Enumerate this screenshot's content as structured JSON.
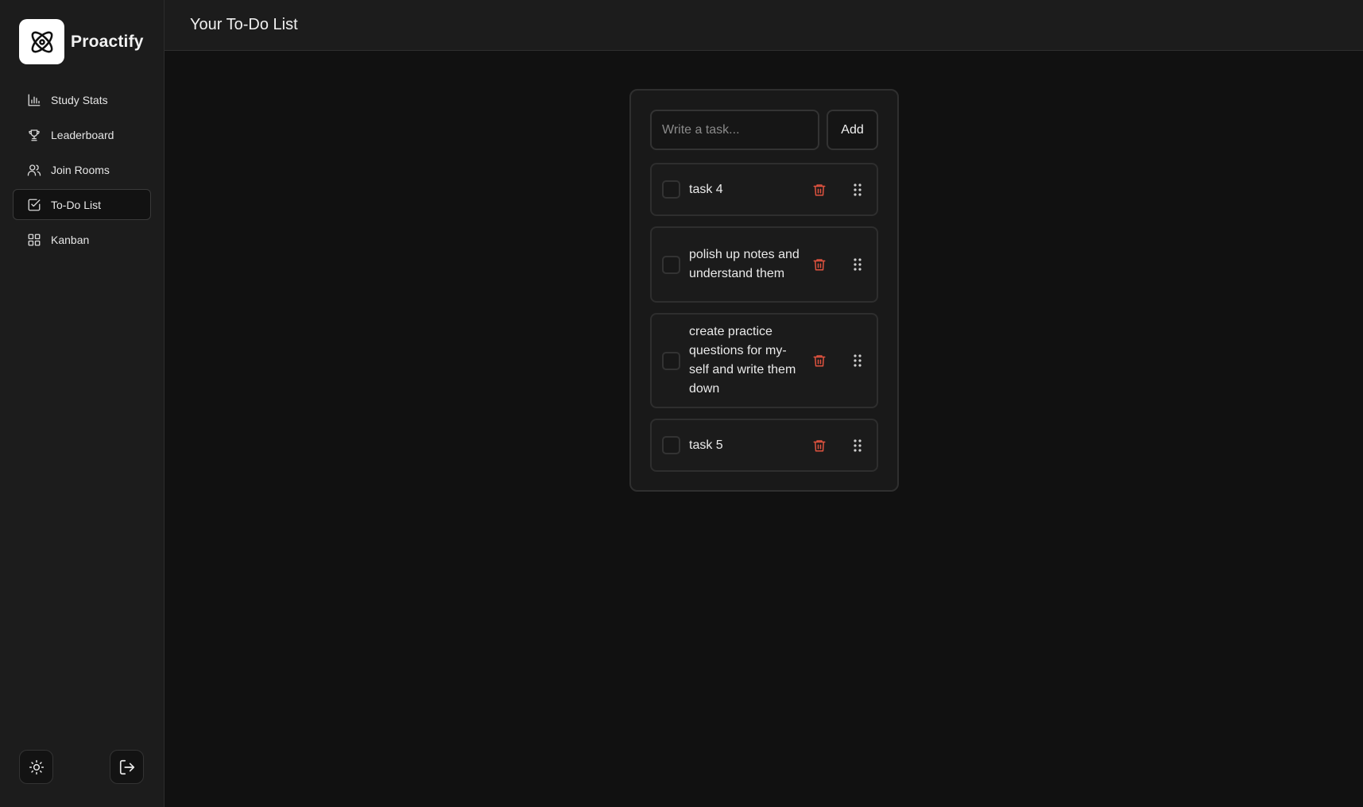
{
  "brand": {
    "name": "Proactify"
  },
  "header": {
    "title": "Your To-Do List"
  },
  "sidebar": {
    "items": [
      {
        "label": "Study Stats",
        "icon": "bar-chart-icon",
        "active": false
      },
      {
        "label": "Leaderboard",
        "icon": "trophy-icon",
        "active": false
      },
      {
        "label": "Join Rooms",
        "icon": "users-icon",
        "active": false
      },
      {
        "label": "To-Do List",
        "icon": "checkbox-icon",
        "active": true
      },
      {
        "label": "Kanban",
        "icon": "grid-icon",
        "active": false
      }
    ],
    "bottom": [
      {
        "icon": "sun-icon",
        "label": "theme toggle"
      },
      {
        "icon": "logout-icon",
        "label": "log out"
      }
    ]
  },
  "todo": {
    "input_placeholder": "Write a task...",
    "add_label": "Add",
    "tasks": [
      {
        "text": "task 4",
        "done": false
      },
      {
        "text": "polish up notes and understand them",
        "done": false
      },
      {
        "text": "create practice questions for my-self and write them down",
        "done": false
      },
      {
        "text": "task 5",
        "done": false
      }
    ]
  },
  "colors": {
    "background": "#111111",
    "sidebar": "#1c1c1c",
    "delete_accent": "#e0533f"
  }
}
